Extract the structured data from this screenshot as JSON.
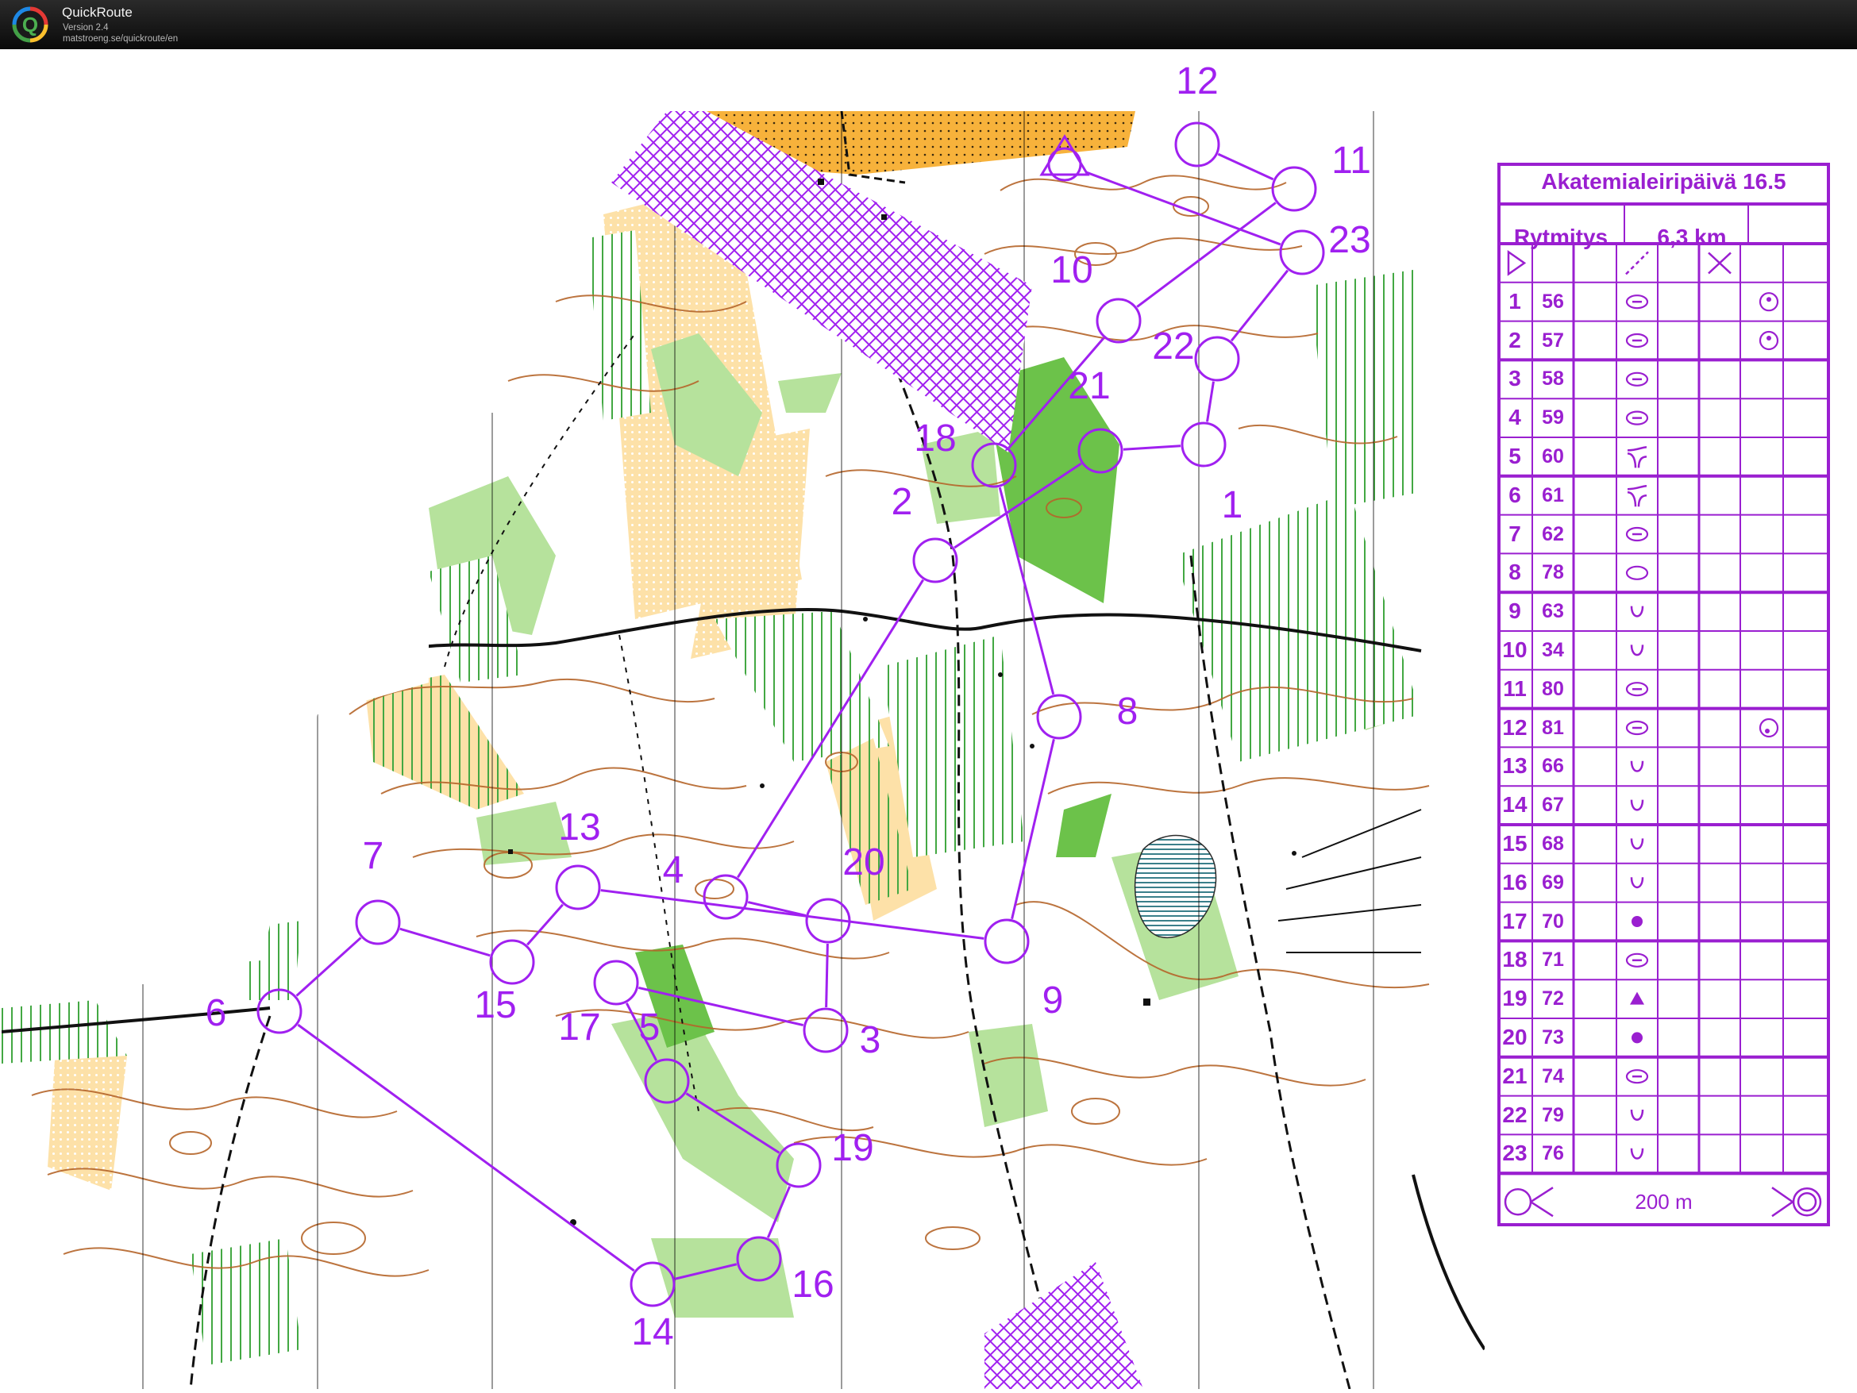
{
  "app": {
    "name": "QuickRoute",
    "version": "Version 2.4",
    "url": "matstroeng.se/quickroute/en"
  },
  "course": {
    "title": "Akatemialeiripäivä 16.5",
    "name": "Rytmitys",
    "length": "6,3 km",
    "scale_label": "200 m",
    "controls": [
      {
        "n": "1",
        "code": "56",
        "symbol": "knoll-elongated",
        "extra": "dot-circle"
      },
      {
        "n": "2",
        "code": "57",
        "symbol": "knoll-elongated",
        "extra": "dot-circle"
      },
      {
        "n": "3",
        "code": "58",
        "symbol": "knoll-elongated",
        "extra": ""
      },
      {
        "n": "4",
        "code": "59",
        "symbol": "knoll-elongated",
        "extra": ""
      },
      {
        "n": "5",
        "code": "60",
        "symbol": "spur",
        "extra": ""
      },
      {
        "n": "6",
        "code": "61",
        "symbol": "spur",
        "extra": ""
      },
      {
        "n": "7",
        "code": "62",
        "symbol": "knoll-elongated",
        "extra": ""
      },
      {
        "n": "8",
        "code": "78",
        "symbol": "elongated-oval",
        "extra": ""
      },
      {
        "n": "9",
        "code": "63",
        "symbol": "depression",
        "extra": ""
      },
      {
        "n": "10",
        "code": "34",
        "symbol": "depression",
        "extra": ""
      },
      {
        "n": "11",
        "code": "80",
        "symbol": "knoll-elongated",
        "extra": ""
      },
      {
        "n": "12",
        "code": "81",
        "symbol": "knoll-elongated",
        "extra": "dot-circle-low"
      },
      {
        "n": "13",
        "code": "66",
        "symbol": "depression",
        "extra": ""
      },
      {
        "n": "14",
        "code": "67",
        "symbol": "depression",
        "extra": ""
      },
      {
        "n": "15",
        "code": "68",
        "symbol": "depression",
        "extra": ""
      },
      {
        "n": "16",
        "code": "69",
        "symbol": "depression",
        "extra": ""
      },
      {
        "n": "17",
        "code": "70",
        "symbol": "boulder-dot",
        "extra": ""
      },
      {
        "n": "18",
        "code": "71",
        "symbol": "knoll-elongated",
        "extra": ""
      },
      {
        "n": "19",
        "code": "72",
        "symbol": "triangle",
        "extra": ""
      },
      {
        "n": "20",
        "code": "73",
        "symbol": "boulder-dot",
        "extra": ""
      },
      {
        "n": "21",
        "code": "74",
        "symbol": "knoll-elongated",
        "extra": ""
      },
      {
        "n": "22",
        "code": "79",
        "symbol": "depression",
        "extra": ""
      },
      {
        "n": "23",
        "code": "76",
        "symbol": "depression",
        "extra": ""
      }
    ]
  },
  "map_labels": [
    "23",
    "22",
    "1",
    "21",
    "2",
    "4",
    "20",
    "3",
    "5",
    "19",
    "16",
    "14",
    "6",
    "7",
    "15",
    "13",
    "17",
    "9",
    "8",
    "18",
    "10",
    "11",
    "12"
  ],
  "colors": {
    "course_purple": "#a020f0",
    "contour_brown": "#b5652a",
    "open_yellow": "#f7b23b",
    "light_yellow": "#fde1a8",
    "forest_green": "#6cc24a",
    "light_green": "#b6e29c",
    "legend_purple": "#9a1fd0"
  }
}
